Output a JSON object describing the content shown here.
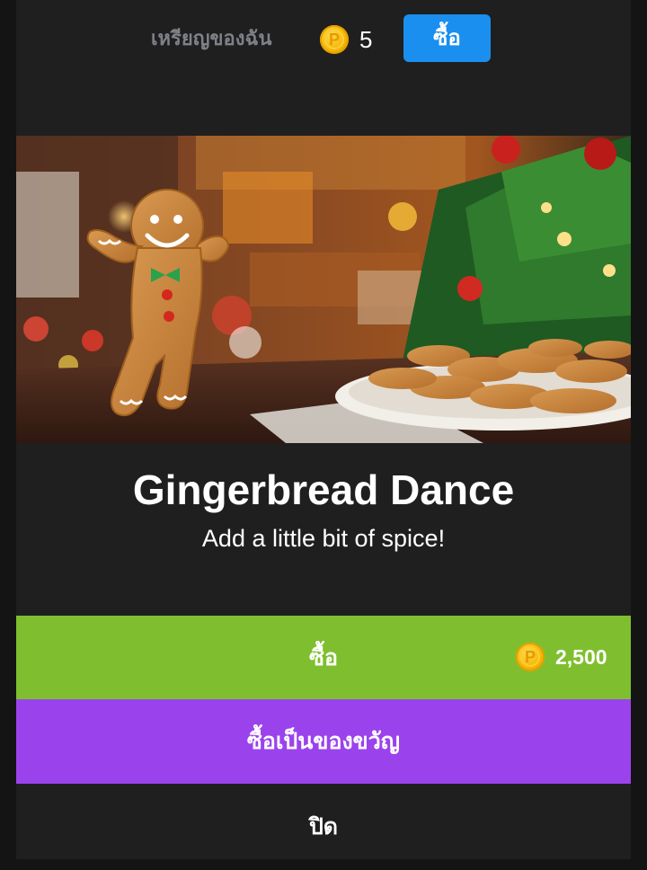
{
  "header": {
    "coins_label": "เหรียญของฉัน",
    "coin_icon": "coin-p-icon",
    "coins_value": "5",
    "buy_label": "ซื้อ"
  },
  "product": {
    "image": "gingerbread-man-christmas-scene",
    "title": "Gingerbread Dance",
    "subtitle": "Add a little bit of spice!",
    "coin_letter": "P",
    "price": "2,500"
  },
  "actions": {
    "buy_label": "ซื้อ",
    "gift_label": "ซื้อเป็นของขวัญ",
    "close_label": "ปิด"
  },
  "colors": {
    "background": "#1f1f1f",
    "buy_button": "#7fbf2f",
    "gift_button": "#9a43ec",
    "top_buy_button": "#1a8fef",
    "coin": "#f6b400"
  }
}
